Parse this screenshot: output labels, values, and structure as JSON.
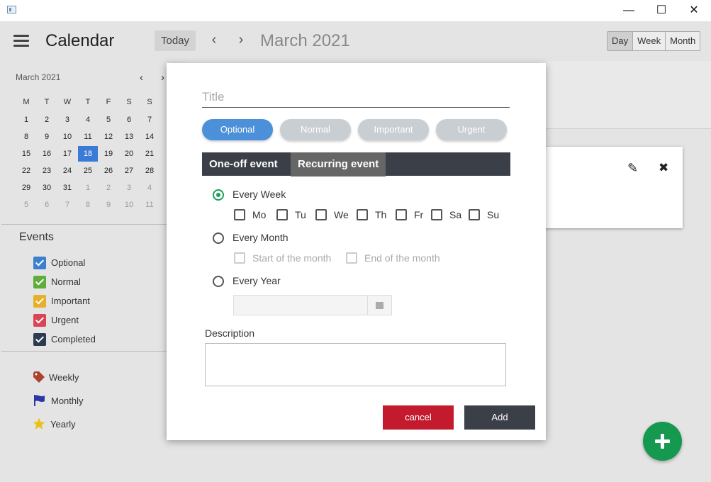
{
  "window": {
    "minimize": "—",
    "maximize": "☐",
    "close": "✕"
  },
  "toolbar": {
    "title": "Calendar",
    "today": "Today",
    "prev": "‹",
    "next": "›",
    "month_title": "March 2021"
  },
  "views": [
    "Day",
    "Week",
    "Month"
  ],
  "active_view": "Day",
  "mini_calendar": {
    "label": "March 2021",
    "prev": "‹",
    "next": "›",
    "weekdays": [
      "M",
      "T",
      "W",
      "T",
      "F",
      "S",
      "S"
    ],
    "weeks": [
      [
        "1",
        "2",
        "3",
        "4",
        "5",
        "6",
        "7"
      ],
      [
        "8",
        "9",
        "10",
        "11",
        "12",
        "13",
        "14"
      ],
      [
        "15",
        "16",
        "17",
        "18",
        "19",
        "20",
        "21"
      ],
      [
        "22",
        "23",
        "24",
        "25",
        "26",
        "27",
        "28"
      ],
      [
        "29",
        "30",
        "31",
        "1",
        "2",
        "3",
        "4"
      ],
      [
        "5",
        "6",
        "7",
        "8",
        "9",
        "10",
        "11"
      ]
    ],
    "selected": "18"
  },
  "events": {
    "heading": "Events",
    "categories": [
      {
        "label": "Optional",
        "color": "#3b7fd0"
      },
      {
        "label": "Normal",
        "color": "#5fae3a"
      },
      {
        "label": "Important",
        "color": "#e6b02a"
      },
      {
        "label": "Urgent",
        "color": "#d94555"
      },
      {
        "label": "Completed",
        "color": "#2c3b52"
      }
    ]
  },
  "recurrence_legend": [
    {
      "label": "Weekly",
      "icon": "tag-icon",
      "color": "#a9442e"
    },
    {
      "label": "Monthly",
      "icon": "flag-icon",
      "color": "#2b37a8"
    },
    {
      "label": "Yearly",
      "icon": "star-icon",
      "color": "#e8c21a"
    }
  ],
  "event_card": {
    "edit_icon": "✎",
    "delete_icon": "✖"
  },
  "dialog": {
    "title_placeholder": "Title",
    "priorities": [
      "Optional",
      "Normal",
      "Important",
      "Urgent"
    ],
    "active_priority": "Optional",
    "tabs": [
      "One-off event",
      "Recurring event"
    ],
    "active_tab": "Recurring event",
    "options": {
      "every_week": "Every Week",
      "days": [
        "Mo",
        "Tu",
        "We",
        "Th",
        "Fr",
        "Sa",
        "Su"
      ],
      "every_month": "Every Month",
      "start_of_month": "Start of the month",
      "end_of_month": "End of the month",
      "every_year": "Every Year"
    },
    "description_label": "Description",
    "cancel": "cancel",
    "add": "Add"
  },
  "fab_label": "+"
}
